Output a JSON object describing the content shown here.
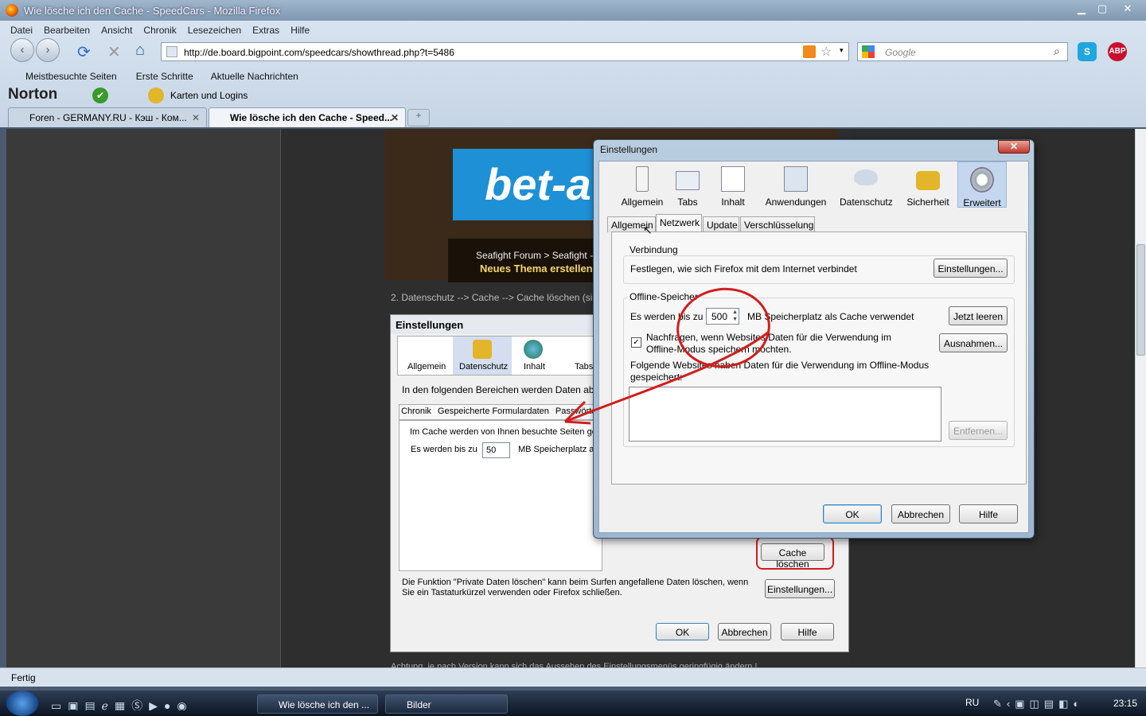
{
  "window": {
    "title": "Wie lösche ich den Cache - SpeedCars - Mozilla Firefox",
    "min": "▁",
    "max": "▢",
    "close": "✕"
  },
  "menu": [
    "Datei",
    "Bearbeiten",
    "Ansicht",
    "Chronik",
    "Lesezeichen",
    "Extras",
    "Hilfe"
  ],
  "url": "http://de.board.bigpoint.com/speedcars/showthread.php?t=5486",
  "search_placeholder": "Google",
  "bookmarks": [
    "Meistbesuchte Seiten",
    "Erste Schritte",
    "Aktuelle Nachrichten"
  ],
  "norton": {
    "brand": "Norton",
    "cards": "Karten und Logins"
  },
  "tabs": [
    {
      "label": "Foren - GERMANY.RU - Кэш - Ком..."
    },
    {
      "label": "Wie lösche ich den Cache - Speed..."
    }
  ],
  "page": {
    "banner": "bet-a",
    "breadcrumb": "Seafight Forum > Seafight - D",
    "new_thread": "Neues Thema erstellen",
    "step_text": "2. Datenschutz --> Cache --> Cache löschen (siehe r",
    "footer_text": "Achtung, je nach Version kann sich das Aussehen des Einstellungsmenüs geringfügig ändern !",
    "old_dialog": {
      "title": "Einstellungen",
      "panes": [
        "Allgemein",
        "Datenschutz",
        "Inhalt",
        "Tabs"
      ],
      "intro": "In den folgenden Bereichen werden Daten abgele",
      "subtabs": [
        "Chronik",
        "Gespeicherte Formulardaten",
        "Passwörter"
      ],
      "cache_text": "Im Cache werden von Ihnen besuchte Seiten ge",
      "limit_label": "Es werden bis zu",
      "limit_value": "50",
      "limit_unit": "MB Speicherplatz als",
      "clear_cache": "Cache löschen",
      "private_text": "Die Funktion \"Private Daten löschen\" kann beim Surfen angefallene Daten löschen, wenn Sie ein Tastaturkürzel verwenden oder Firefox schließen.",
      "settings": "Einstellungen...",
      "ok": "OK",
      "cancel": "Abbrechen",
      "help": "Hilfe"
    }
  },
  "dialog": {
    "title": "Einstellungen",
    "panes": [
      "Allgemein",
      "Tabs",
      "Inhalt",
      "Anwendungen",
      "Datenschutz",
      "Sicherheit",
      "Erweitert"
    ],
    "subtabs": [
      "Allgemein",
      "Netzwerk",
      "Update",
      "Verschlüsselung"
    ],
    "connection": {
      "title": "Verbindung",
      "text": "Festlegen, wie sich Firefox mit dem Internet verbindet",
      "button": "Einstellungen..."
    },
    "offline": {
      "title": "Offline-Speicher",
      "limit_label": "Es werden bis zu",
      "limit_value": "500",
      "limit_unit": "MB Speicherplatz als Cache verwendet",
      "clear": "Jetzt leeren",
      "ask_text": "Nachfragen, wenn Websites Daten für die Verwendung im Offline-Modus speichern möchten.",
      "exceptions": "Ausnahmen...",
      "list_label": "Folgende Websites haben Daten für die Verwendung im Offline-Modus gespeichert:",
      "remove": "Entfernen..."
    },
    "ok": "OK",
    "cancel": "Abbrechen",
    "help": "Hilfe"
  },
  "status": "Fertig",
  "taskbar": {
    "items": [
      "Wie lösche ich den ...",
      "Bilder"
    ],
    "lang": "RU",
    "time": "23:15"
  },
  "colors": {
    "annotation_red": "#d21d1d",
    "dialog_frame": "#9db6cf"
  }
}
